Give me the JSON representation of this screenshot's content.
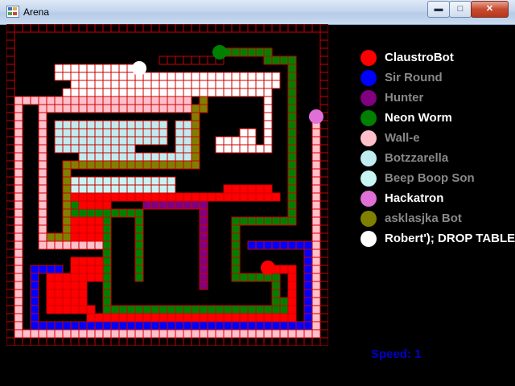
{
  "window": {
    "title": "Arena"
  },
  "players": [
    {
      "name": "ClaustroBot",
      "color": "#ff0000",
      "text_color": "#ffffff"
    },
    {
      "name": "Sir Round",
      "color": "#0000ff",
      "text_color": "#888888"
    },
    {
      "name": "Hunter",
      "color": "#800080",
      "text_color": "#888888"
    },
    {
      "name": "Neon Worm",
      "color": "#008000",
      "text_color": "#ffffff"
    },
    {
      "name": "Wall-e",
      "color": "#ffc0cb",
      "text_color": "#888888"
    },
    {
      "name": "Botzzarella",
      "color": "#c0ecf0",
      "text_color": "#888888"
    },
    {
      "name": "Beep Boop Son",
      "color": "#c8f4f4",
      "text_color": "#888888"
    },
    {
      "name": "Hackatron",
      "color": "#e070d8",
      "text_color": "#ffffff"
    },
    {
      "name": "asklasjka Bot",
      "color": "#808000",
      "text_color": "#888888"
    },
    {
      "name": "Robert'); DROP TABLE",
      "color": "#ffffff",
      "text_color": "#ffffff"
    }
  ],
  "speed_label": "Speed: 1",
  "colors": {
    "background": "#000000",
    "grid": "#cc0000",
    "speed": "#0000cc"
  }
}
